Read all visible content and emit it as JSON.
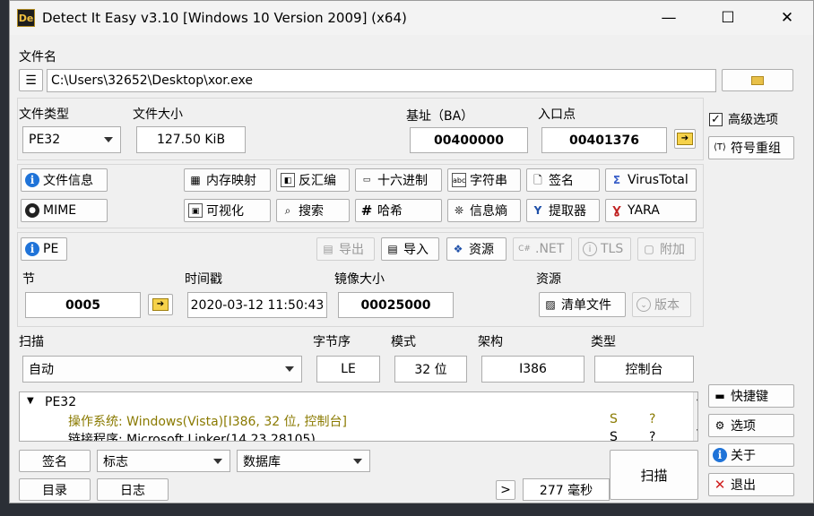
{
  "window": {
    "title": "Detect It Easy v3.10 [Windows 10 Version 2009] (x64)",
    "icon_text": "De",
    "minimize": "—",
    "maximize": "☐",
    "close": "✕"
  },
  "file": {
    "label": "文件名",
    "path": "C:\\Users\\32652\\Desktop\\xor.exe",
    "browse_icon": "folder-icon"
  },
  "info": {
    "type_label": "文件类型",
    "type_value": "PE32",
    "size_label": "文件大小",
    "size_value": "127.50 KiB",
    "base_label": "基址（BA）",
    "base_value": "00400000",
    "entry_label": "入口点",
    "entry_value": "00401376"
  },
  "tools": {
    "file_info": "文件信息",
    "memory_map": "内存映射",
    "disasm": "反汇编",
    "hex": "十六进制",
    "strings": "字符串",
    "signature": "签名",
    "virustotal": "VirusTotal",
    "mime": "MIME",
    "visualize": "可视化",
    "search": "搜索",
    "hash": "哈希",
    "entropy": "信息熵",
    "extractor": "提取器",
    "yara": "YARA"
  },
  "pe": {
    "tab": "PE",
    "export": "导出",
    "import": "导入",
    "resources": "资源",
    "net": ".NET",
    "tls": "TLS",
    "overlay": "附加",
    "section_label": "节",
    "section_value": "0005",
    "timestamp_label": "时间戳",
    "timestamp_value": "2020-03-12 11:50:43",
    "image_size_label": "镜像大小",
    "image_size_value": "00025000",
    "res_label": "资源",
    "manifest": "清单文件",
    "version": "版本"
  },
  "scan": {
    "label": "扫描",
    "mode_value": "自动",
    "endian_label": "字节序",
    "endian_value": "LE",
    "mode_label": "模式",
    "bits_value": "32 位",
    "arch_label": "架构",
    "arch_value": "I386",
    "type_label": "类型",
    "type_value": "控制台"
  },
  "results": {
    "root": "PE32",
    "rows": [
      {
        "text": "操作系统: Windows(Vista)[I386, 32 位, 控制台]",
        "s": "S",
        "q": "?"
      },
      {
        "text": "链接程序: Microsoft Linker(14.23.28105)",
        "s": "S",
        "q": "?"
      }
    ]
  },
  "bottom": {
    "signature": "签名",
    "flags_value": "标志",
    "database_value": "数据库",
    "directory": "目录",
    "log": "日志",
    "more": ">",
    "time": "277 毫秒",
    "scan": "扫描"
  },
  "side": {
    "advanced": "高级选项",
    "advanced_checked": "✓",
    "demangle": "符号重组",
    "shortcuts": "快捷键",
    "options": "选项",
    "about": "关于",
    "exit": "退出"
  },
  "colors": {
    "result_highlight": "#8a7a00",
    "info_blue": "#1f73d8"
  }
}
